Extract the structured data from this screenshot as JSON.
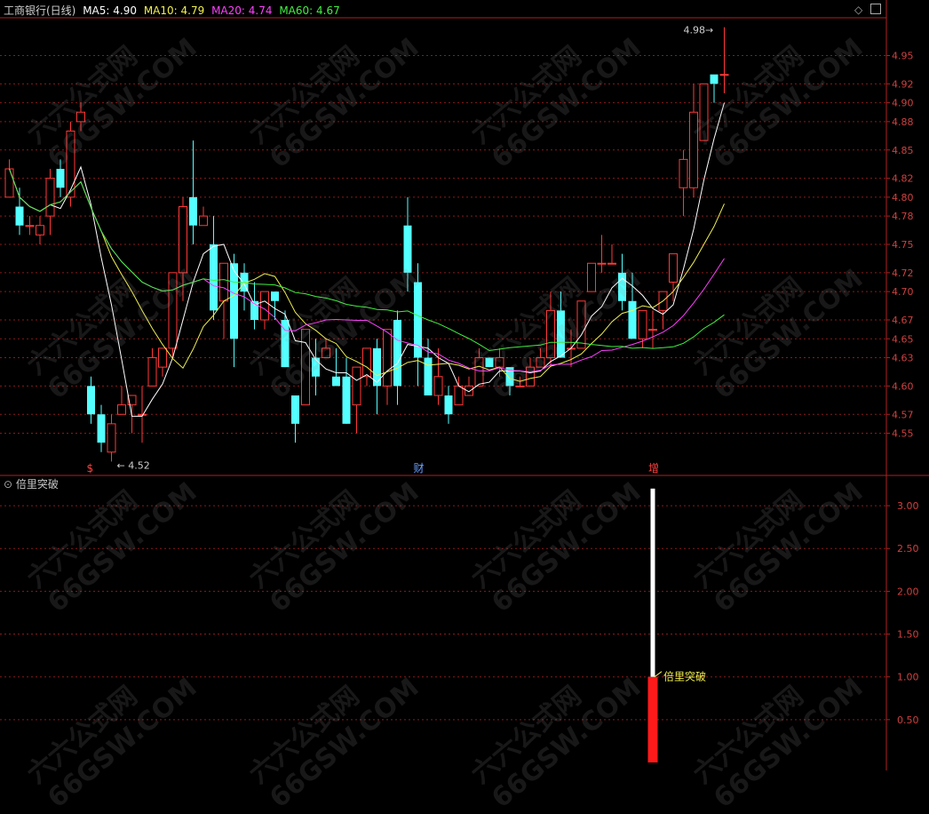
{
  "header": {
    "title": "工商银行(日线)",
    "ma5": "MA5: 4.90",
    "ma10": "MA10: 4.79",
    "ma20": "MA20: 4.74",
    "ma60": "MA60: 4.67",
    "colors": {
      "title": "#d0d0d0",
      "ma5": "#ffffff",
      "ma10": "#f0f050",
      "ma20": "#ff40ff",
      "ma60": "#40f040"
    }
  },
  "indicator": {
    "title": "倍里突破",
    "label": "倍里突破"
  },
  "watermark": {
    "line1": "六六公式网",
    "line2": "66GSW.COM"
  },
  "chart_data": [
    {
      "type": "candlestick",
      "y_axis_ticks": [
        "4.55",
        "4.57",
        "4.60",
        "4.63",
        "4.65",
        "4.67",
        "4.70",
        "4.72",
        "4.75",
        "4.78",
        "4.80",
        "4.82",
        "4.85",
        "4.88",
        "4.90",
        "4.92",
        "4.95"
      ],
      "ylim": [
        4.51,
        4.99
      ],
      "annotations": {
        "low_label": "4.52",
        "high_label": "4.98"
      },
      "markers": [
        {
          "index": 8,
          "text": "$",
          "color": "#ff4040"
        },
        {
          "index": 40,
          "text": "财",
          "color": "#6aa0ff"
        },
        {
          "index": 63,
          "text": "增",
          "color": "#ff4040"
        }
      ],
      "candles": [
        [
          4.8,
          4.84,
          4.82,
          4.83
        ],
        [
          4.79,
          4.81,
          4.76,
          4.77
        ],
        [
          4.77,
          4.78,
          4.76,
          4.77
        ],
        [
          4.76,
          4.78,
          4.75,
          4.77
        ],
        [
          4.78,
          4.83,
          4.76,
          4.82
        ],
        [
          4.83,
          4.84,
          4.8,
          4.81
        ],
        [
          4.8,
          4.88,
          4.79,
          4.87
        ],
        [
          4.88,
          4.9,
          4.87,
          4.89
        ],
        [
          4.6,
          4.61,
          4.56,
          4.57
        ],
        [
          4.57,
          4.58,
          4.53,
          4.54
        ],
        [
          4.53,
          4.57,
          4.52,
          4.56
        ],
        [
          4.57,
          4.6,
          4.57,
          4.58
        ],
        [
          4.58,
          4.59,
          4.55,
          4.59
        ],
        [
          4.57,
          4.6,
          4.54,
          4.57
        ],
        [
          4.6,
          4.64,
          4.6,
          4.63
        ],
        [
          4.62,
          4.64,
          4.61,
          4.64
        ],
        [
          4.64,
          4.72,
          4.63,
          4.72
        ],
        [
          4.72,
          4.8,
          4.69,
          4.79
        ],
        [
          4.8,
          4.86,
          4.75,
          4.77
        ],
        [
          4.77,
          4.79,
          4.77,
          4.78
        ],
        [
          4.75,
          4.78,
          4.67,
          4.68
        ],
        [
          4.69,
          4.71,
          4.65,
          4.73
        ],
        [
          4.73,
          4.74,
          4.62,
          4.65
        ],
        [
          4.72,
          4.73,
          4.68,
          4.7
        ],
        [
          4.69,
          4.71,
          4.66,
          4.67
        ],
        [
          4.67,
          4.7,
          4.66,
          4.7
        ],
        [
          4.7,
          4.7,
          4.67,
          4.69
        ],
        [
          4.67,
          4.68,
          4.62,
          4.62
        ],
        [
          4.59,
          4.59,
          4.54,
          4.56
        ],
        [
          4.58,
          4.64,
          4.58,
          4.66
        ],
        [
          4.63,
          4.65,
          4.59,
          4.61
        ],
        [
          4.63,
          4.65,
          4.63,
          4.64
        ],
        [
          4.61,
          4.64,
          4.6,
          4.6
        ],
        [
          4.61,
          4.63,
          4.56,
          4.56
        ],
        [
          4.58,
          4.62,
          4.55,
          4.62
        ],
        [
          4.61,
          4.64,
          4.6,
          4.64
        ],
        [
          4.64,
          4.65,
          4.57,
          4.6
        ],
        [
          4.6,
          4.66,
          4.58,
          4.66
        ],
        [
          4.67,
          4.68,
          4.58,
          4.6
        ],
        [
          4.77,
          4.8,
          4.7,
          4.72
        ],
        [
          4.71,
          4.73,
          4.6,
          4.63
        ],
        [
          4.63,
          4.65,
          4.59,
          4.59
        ],
        [
          4.59,
          4.64,
          4.58,
          4.61
        ],
        [
          4.59,
          4.6,
          4.56,
          4.57
        ],
        [
          4.58,
          4.61,
          4.58,
          4.6
        ],
        [
          4.59,
          4.61,
          4.59,
          4.6
        ],
        [
          4.6,
          4.64,
          4.6,
          4.63
        ],
        [
          4.63,
          4.63,
          4.62,
          4.62
        ],
        [
          4.62,
          4.64,
          4.61,
          4.63
        ],
        [
          4.62,
          4.6,
          4.59,
          4.6
        ],
        [
          4.6,
          4.61,
          4.6,
          4.6
        ],
        [
          4.6,
          4.63,
          4.6,
          4.62
        ],
        [
          4.62,
          4.64,
          4.62,
          4.63
        ],
        [
          4.63,
          4.7,
          4.62,
          4.68
        ],
        [
          4.68,
          4.7,
          4.63,
          4.63
        ],
        [
          4.64,
          4.66,
          4.62,
          4.64
        ],
        [
          4.64,
          4.69,
          4.64,
          4.69
        ],
        [
          4.7,
          4.73,
          4.7,
          4.73
        ],
        [
          4.73,
          4.76,
          4.72,
          4.73
        ],
        [
          4.73,
          4.75,
          4.73,
          4.73
        ],
        [
          4.72,
          4.74,
          4.68,
          4.69
        ],
        [
          4.69,
          4.72,
          4.68,
          4.65
        ],
        [
          4.65,
          4.67,
          4.64,
          4.68
        ],
        [
          4.66,
          4.68,
          4.64,
          4.66
        ],
        [
          4.68,
          4.7,
          4.66,
          4.7
        ],
        [
          4.71,
          4.73,
          4.69,
          4.74
        ],
        [
          4.81,
          4.85,
          4.78,
          4.84
        ],
        [
          4.81,
          4.92,
          4.8,
          4.89
        ],
        [
          4.86,
          4.92,
          4.86,
          4.92
        ],
        [
          4.93,
          4.92,
          4.9,
          4.92
        ],
        [
          4.93,
          4.98,
          4.91,
          4.93
        ]
      ],
      "ma_lines": [
        {
          "name": "MA5",
          "color": "#ffffff"
        },
        {
          "name": "MA10",
          "color": "#f0f050"
        },
        {
          "name": "MA20",
          "color": "#ff40ff"
        },
        {
          "name": "MA60",
          "color": "#40f040"
        }
      ]
    },
    {
      "type": "bar",
      "title": "倍里突破",
      "y_axis_ticks": [
        "0.50",
        "1.00",
        "1.50",
        "2.00",
        "2.50",
        "3.00"
      ],
      "ylim": [
        0,
        3.25
      ],
      "bars": [
        {
          "index": 63,
          "from": 0,
          "to": 1.0,
          "color": "#ff1a1a"
        },
        {
          "index": 63,
          "from": 1.0,
          "to": 3.2,
          "color": "#ffffff"
        }
      ]
    }
  ]
}
